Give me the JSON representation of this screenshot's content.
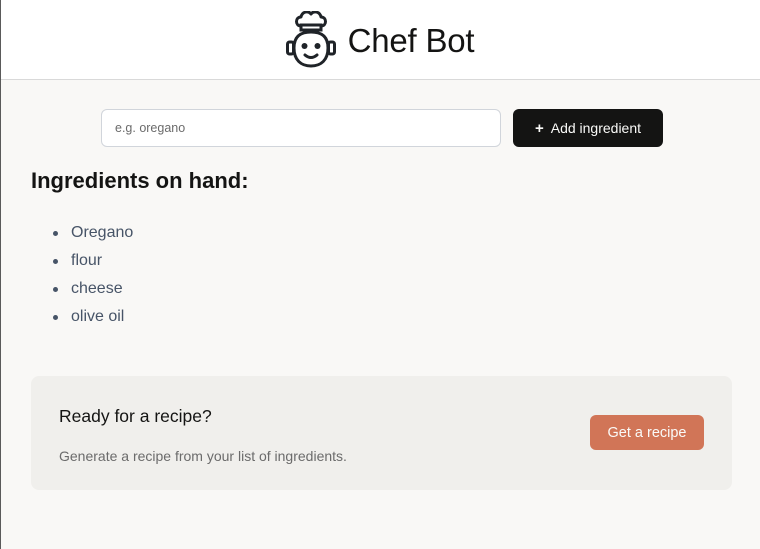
{
  "header": {
    "brand": "Chef Bot",
    "logo_icon": "chef-robot-icon"
  },
  "form": {
    "placeholder": "e.g. oregano",
    "value": "",
    "add_icon": "plus-icon",
    "add_label": "Add ingredient"
  },
  "ingredients": {
    "heading": "Ingredients on hand:",
    "items": [
      "Oregano",
      "flour",
      "cheese",
      "olive oil"
    ]
  },
  "recipe_card": {
    "title": "Ready for a recipe?",
    "description": "Generate a recipe from your list of ingredients.",
    "button_label": "Get a recipe"
  },
  "colors": {
    "accent": "#d17557",
    "dark_button": "#141413",
    "page_bg": "#f9f8f6",
    "card_bg": "#f0efec"
  }
}
